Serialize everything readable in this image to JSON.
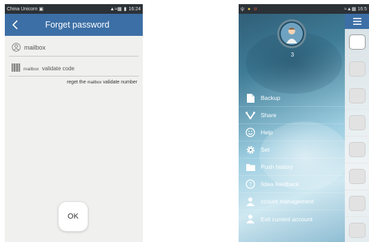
{
  "left_screen": {
    "status": {
      "carrier": "China Unicorn",
      "time": "16:24"
    },
    "header": {
      "title": "Forget password"
    },
    "mailbox_field": {
      "label": "mailbox"
    },
    "code_field": {
      "label_small": "mailbox",
      "label": "validate code"
    },
    "reget_link": {
      "prefix": "reget the",
      "mid": "mailbox",
      "suffix": "validate number"
    },
    "ok_button": {
      "label": "OK"
    }
  },
  "right_screen": {
    "status": {
      "time": "16:5"
    },
    "profile": {
      "name": "3"
    },
    "menu": [
      {
        "label": "Backup",
        "icon": "backup-icon"
      },
      {
        "label": "Share",
        "icon": "share-icon"
      },
      {
        "label": "Help",
        "icon": "help-icon"
      },
      {
        "label": "Set",
        "icon": "gear-icon"
      },
      {
        "label": "Push history",
        "icon": "folder-icon"
      },
      {
        "label": "Iidea feedback",
        "icon": "question-icon"
      },
      {
        "label": "ccount management",
        "icon": "person-icon"
      },
      {
        "label": "Exit current account",
        "icon": "person-icon"
      }
    ]
  },
  "colors": {
    "header_blue": "#3c6fa6",
    "status_bar": "#2b3137"
  }
}
